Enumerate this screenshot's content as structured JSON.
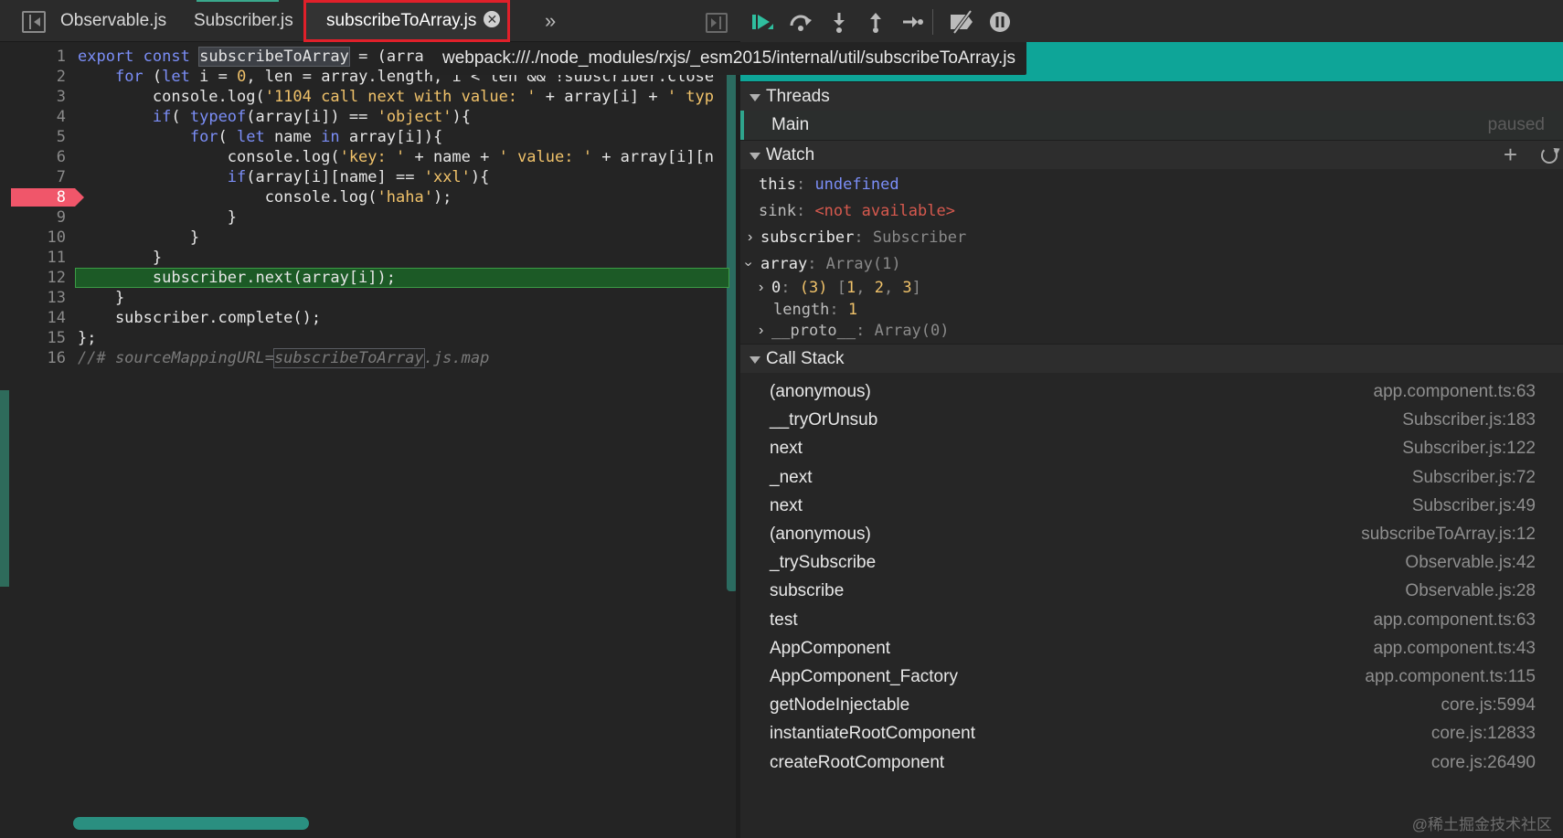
{
  "tabs": [
    {
      "label": "Observable.js"
    },
    {
      "label": "Subscriber.js"
    },
    {
      "label": "subscribeToArray.js",
      "active": true
    }
  ],
  "path_tooltip": "webpack:///./node_modules/rxjs/_esm2015/internal/util/subscribeToArray.js",
  "editor": {
    "breakpoint_line": 8,
    "exec_line": 12,
    "line_numbers": [
      "1",
      "2",
      "3",
      "4",
      "5",
      "6",
      "7",
      "8",
      "9",
      "10",
      "11",
      "12",
      "13",
      "14",
      "15",
      "16"
    ]
  },
  "threads": {
    "title": "Threads",
    "main_name": "Main",
    "main_status": "paused"
  },
  "watch": {
    "title": "Watch",
    "items": [
      {
        "key": "this",
        "value": "undefined"
      },
      {
        "key": "sink",
        "value": "<not available>"
      },
      {
        "key": "subscriber",
        "value": "Subscriber"
      },
      {
        "key": "array",
        "value": "Array(1)"
      },
      {
        "key": "0",
        "count": "(3)",
        "values": [
          "1",
          "2",
          "3"
        ]
      },
      {
        "key": "length",
        "value": "1"
      },
      {
        "key": "__proto__",
        "value": "Array(0)"
      }
    ]
  },
  "call_stack": {
    "title": "Call Stack",
    "frames": [
      {
        "fn": "(anonymous)",
        "loc": "app.component.ts:63"
      },
      {
        "fn": "__tryOrUnsub",
        "loc": "Subscriber.js:183"
      },
      {
        "fn": "next",
        "loc": "Subscriber.js:122"
      },
      {
        "fn": "_next",
        "loc": "Subscriber.js:72"
      },
      {
        "fn": "next",
        "loc": "Subscriber.js:49"
      },
      {
        "fn": "(anonymous)",
        "loc": "subscribeToArray.js:12"
      },
      {
        "fn": "_trySubscribe",
        "loc": "Observable.js:42"
      },
      {
        "fn": "subscribe",
        "loc": "Observable.js:28"
      },
      {
        "fn": "test",
        "loc": "app.component.ts:63"
      },
      {
        "fn": "AppComponent",
        "loc": "app.component.ts:43"
      },
      {
        "fn": "AppComponent_Factory",
        "loc": "app.component.ts:115"
      },
      {
        "fn": "getNodeInjectable",
        "loc": "core.js:5994"
      },
      {
        "fn": "instantiateRootComponent",
        "loc": "core.js:12833"
      },
      {
        "fn": "createRootComponent",
        "loc": "core.js:26490"
      }
    ]
  },
  "watermark": "@稀土掘金技术社区",
  "colors": {
    "accent": "#0ea598",
    "breakpoint": "#f0566a",
    "exec_highlight": "#1c5a26",
    "active_tab_border": "#e0202a"
  }
}
